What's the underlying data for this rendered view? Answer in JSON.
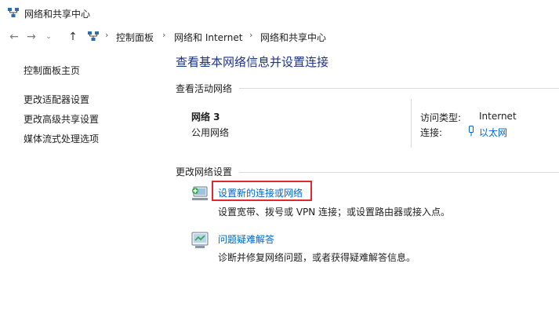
{
  "window": {
    "title": "网络和共享中心"
  },
  "address": {
    "crumbs": [
      "控制面板",
      "网络和 Internet",
      "网络和共享中心"
    ]
  },
  "sidebar": {
    "home": "控制面板主页",
    "items": [
      "更改适配器设置",
      "更改高级共享设置",
      "媒体流式处理选项"
    ]
  },
  "main": {
    "title": "查看基本网络信息并设置连接",
    "active_section": "查看活动网络",
    "network": {
      "name": "网络 3",
      "type": "公用网络",
      "access_label": "访问类型:",
      "access_value": "Internet",
      "connection_label": "连接:",
      "connection_value": "以太网"
    },
    "change_section": "更改网络设置",
    "tasks": [
      {
        "link": "设置新的连接或网络",
        "desc": "设置宽带、拨号或 VPN 连接；或设置路由器或接入点。",
        "icon": "new-connection-icon"
      },
      {
        "link": "问题疑难解答",
        "desc": "诊断并修复网络问题，或者获得疑难解答信息。",
        "icon": "troubleshoot-icon"
      }
    ]
  },
  "colors": {
    "link": "#0066cc",
    "title": "#1e3287",
    "highlight": "#e0282e"
  }
}
